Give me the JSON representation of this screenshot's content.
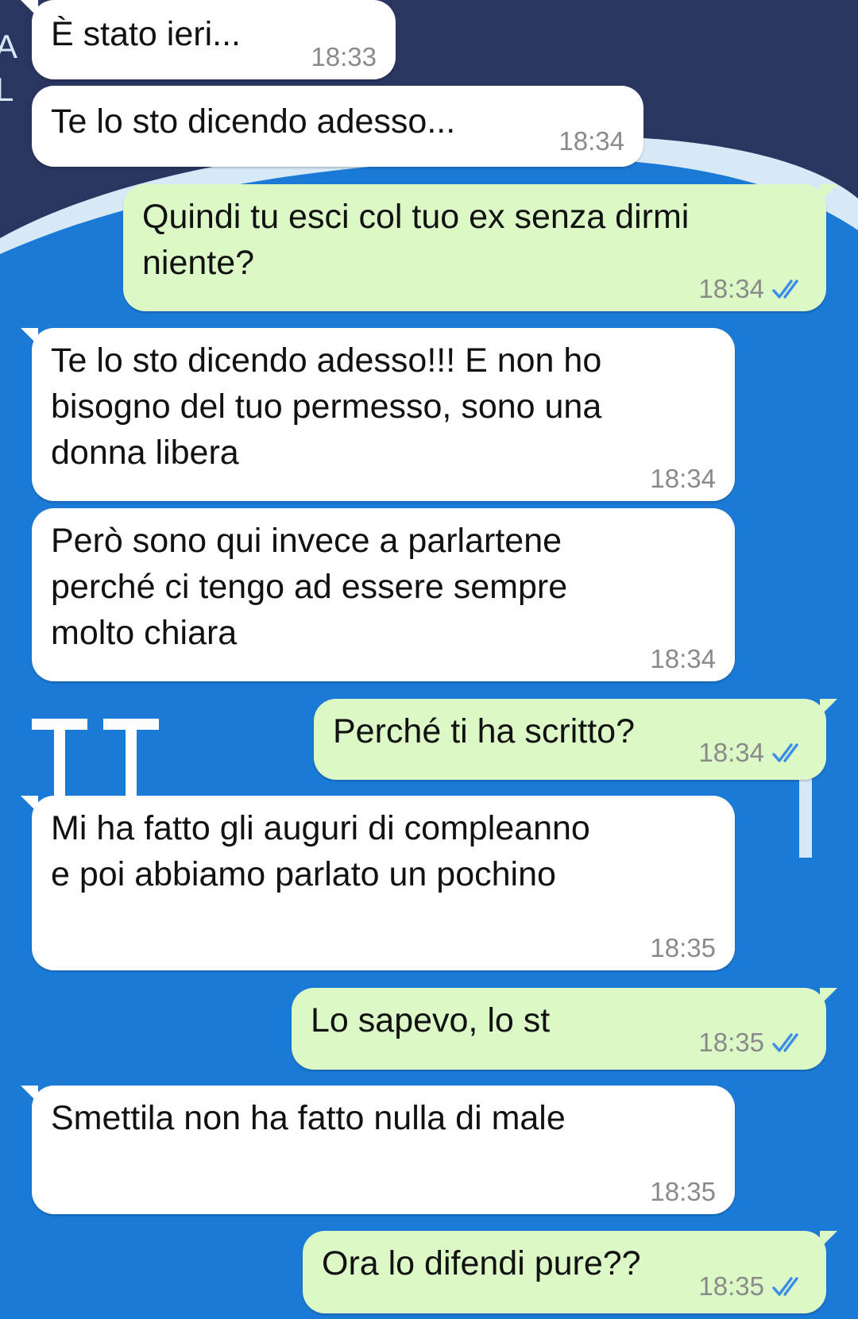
{
  "colors": {
    "incoming_bubble": "#ffffff",
    "outgoing_bubble": "#dcf8c6",
    "timestamp": "#8a8a8a",
    "read_ticks": "#3b8fe6",
    "wallpaper_dark": "#2a3660",
    "wallpaper_blue": "#1b7ad6"
  },
  "wallpaper": {
    "left_letters": "A\nL"
  },
  "messages": [
    {
      "direction": "incoming",
      "text": "È stato ieri...",
      "time": "18:33"
    },
    {
      "direction": "incoming",
      "text": "Te lo sto dicendo adesso...",
      "time": "18:34"
    },
    {
      "direction": "outgoing",
      "text": "Quindi tu esci col tuo ex senza dirmi\nniente?",
      "time": "18:34",
      "status_icon": "double-check-read-icon"
    },
    {
      "direction": "incoming",
      "text": "Te lo sto dicendo adesso!!! E non ho\nbisogno del tuo permesso, sono una\ndonna libera",
      "time": "18:34"
    },
    {
      "direction": "incoming",
      "text": "Però sono qui invece a parlartene\nperché ci tengo ad essere sempre\nmolto chiara",
      "time": "18:34"
    },
    {
      "direction": "outgoing",
      "text": "Perché ti ha scritto?",
      "time": "18:34",
      "status_icon": "double-check-read-icon"
    },
    {
      "direction": "incoming",
      "text": "Mi ha fatto gli auguri di compleanno\ne poi abbiamo parlato un pochino",
      "time": "18:35"
    },
    {
      "direction": "outgoing",
      "text": "Lo sapevo, lo st",
      "time": "18:35",
      "status_icon": "double-check-read-icon"
    },
    {
      "direction": "incoming",
      "text": "Smettila non ha fatto nulla di male",
      "time": "18:35"
    },
    {
      "direction": "outgoing",
      "text": "Ora lo difendi pure??",
      "time": "18:35",
      "status_icon": "double-check-read-icon"
    }
  ]
}
